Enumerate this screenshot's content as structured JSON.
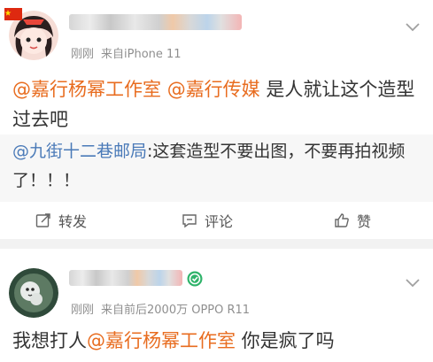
{
  "posts": [
    {
      "meta": {
        "time": "刚刚",
        "source": "来自iPhone 11"
      },
      "body": {
        "mention_1": "@嘉行杨幂工作室",
        "mention_2": "@嘉行传媒",
        "text": " 是人就让这个造型过去吧"
      },
      "repost": {
        "mention": "@九街十二巷邮局",
        "text": ":这套造型不要出图，不要再拍视频了！！！"
      },
      "actions": {
        "forward": "转发",
        "comment": "评论",
        "like": "赞"
      }
    },
    {
      "meta": {
        "time": "刚刚",
        "source": "来自前后2000万 OPPO R11"
      },
      "body": {
        "prefix": "我想打人",
        "mention": "@嘉行杨幂工作室",
        "suffix": " 你是疯了吗"
      }
    }
  ],
  "colors": {
    "mention": "#e86c1f",
    "repost_mention": "#4a7ab8",
    "verified": "#2fb36a"
  }
}
